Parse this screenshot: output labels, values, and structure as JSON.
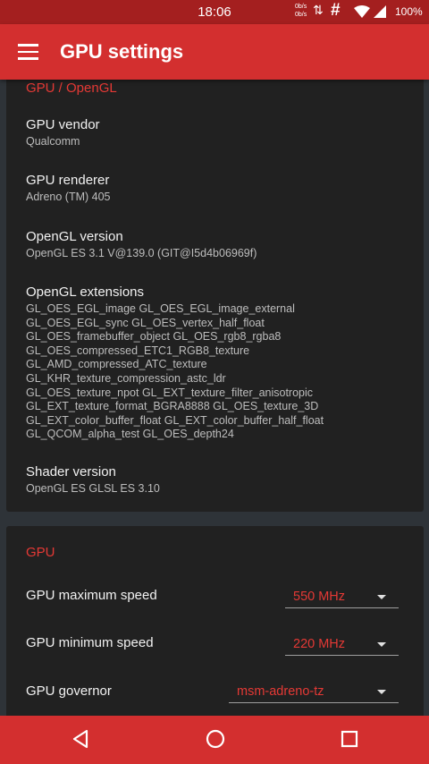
{
  "status_bar": {
    "time": "18:06",
    "net_speed_up": "0b/s",
    "net_speed_down": "0b/s",
    "battery": "100%"
  },
  "toolbar": {
    "title": "GPU settings"
  },
  "opengl_card": {
    "header": "GPU / OpenGL",
    "gpu_vendor": {
      "title": "GPU vendor",
      "value": "Qualcomm"
    },
    "gpu_renderer": {
      "title": "GPU renderer",
      "value": "Adreno (TM) 405"
    },
    "opengl_version": {
      "title": "OpenGL version",
      "value": "OpenGL ES 3.1 V@139.0 (GIT@I5d4b06969f)"
    },
    "opengl_extensions": {
      "title": "OpenGL extensions",
      "lines": [
        "GL_OES_EGL_image GL_OES_EGL_image_external",
        "GL_OES_EGL_sync GL_OES_vertex_half_float",
        "GL_OES_framebuffer_object GL_OES_rgb8_rgba8",
        "GL_OES_compressed_ETC1_RGB8_texture",
        "GL_AMD_compressed_ATC_texture",
        "GL_KHR_texture_compression_astc_ldr",
        "GL_OES_texture_npot GL_EXT_texture_filter_anisotropic",
        "GL_EXT_texture_format_BGRA8888 GL_OES_texture_3D",
        "GL_EXT_color_buffer_float GL_EXT_color_buffer_half_float",
        "GL_QCOM_alpha_test GL_OES_depth24"
      ]
    },
    "shader_version": {
      "title": "Shader version",
      "value": "OpenGL ES GLSL ES 3.10"
    }
  },
  "gpu_card": {
    "header": "GPU",
    "max_speed": {
      "title": "GPU maximum speed",
      "value": "550 MHz"
    },
    "min_speed": {
      "title": "GPU minimum speed",
      "value": "220 MHz"
    },
    "governor": {
      "title": "GPU governor",
      "value": "msm-adreno-tz"
    }
  },
  "colors": {
    "accent": "#d32f2f",
    "status_bar": "#a41f1f",
    "card_bg": "#212121",
    "page_bg": "#2e3338"
  }
}
